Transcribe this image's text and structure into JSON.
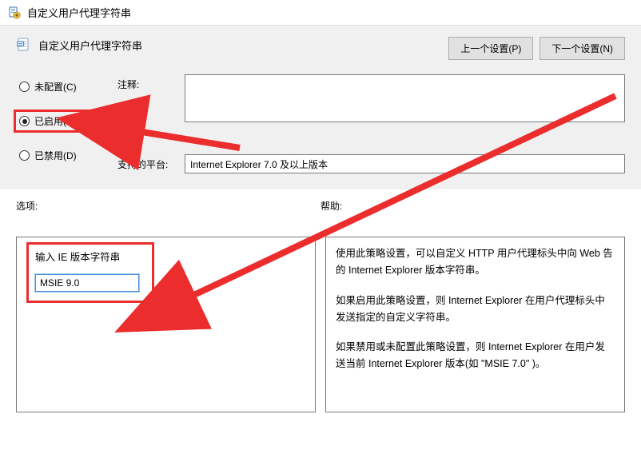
{
  "window": {
    "title": "自定义用户代理字符串"
  },
  "header": {
    "title": "自定义用户代理字符串",
    "btn_prev": "上一个设置(P)",
    "btn_next": "下一个设置(N)"
  },
  "radios": {
    "not_configured": "未配置(C)",
    "enabled": "已启用(E)",
    "disabled": "已禁用(D)"
  },
  "fields": {
    "comment_label": "注释:",
    "comment_value": "",
    "platform_label": "支持的平台:",
    "platform_value": "Internet Explorer 7.0 及以上版本"
  },
  "lower": {
    "options_header": "选项:",
    "help_header": "帮助:"
  },
  "options": {
    "label": "输入 IE 版本字符串",
    "value": "MSIE 9.0"
  },
  "help": {
    "p1": "使用此策略设置，可以自定义 HTTP 用户代理标头中向 Web 告的 Internet Explorer 版本字符串。",
    "p2": "如果启用此策略设置，则 Internet Explorer 在用户代理标头中发送指定的自定义字符串。",
    "p3": "如果禁用或未配置此策略设置，则 Internet Explorer 在用户发送当前 Internet Explorer 版本(如 \"MSIE 7.0\" )。"
  }
}
